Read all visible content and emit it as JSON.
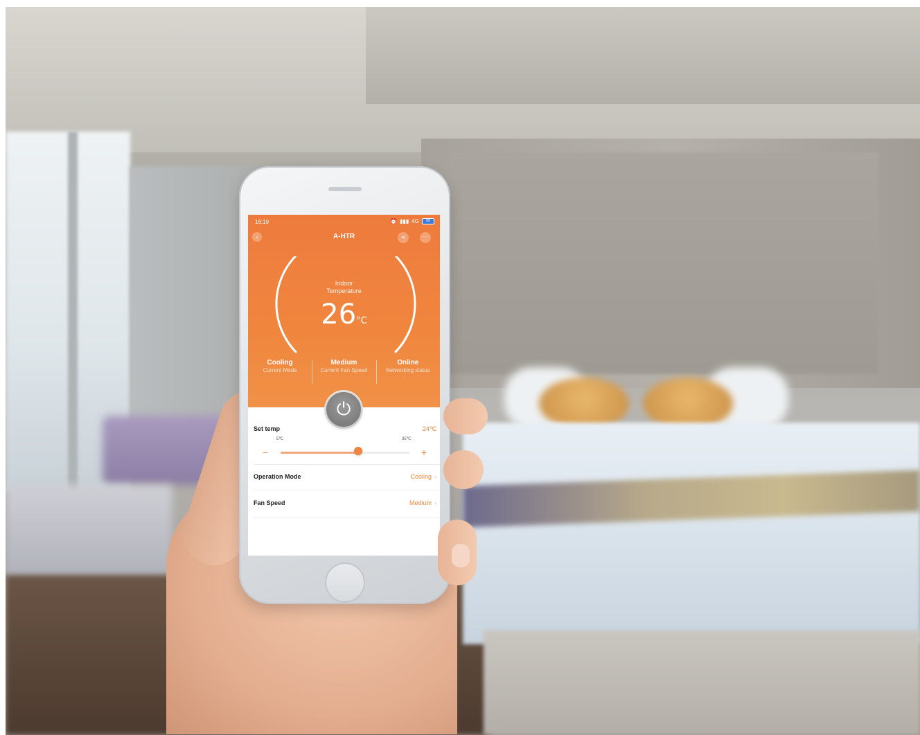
{
  "status_bar": {
    "time": "16:19",
    "icons": [
      "alarm-icon",
      "signal-icon"
    ],
    "network": "4G",
    "battery": "69"
  },
  "nav": {
    "title": "A-HTR",
    "back_icon": "back-icon",
    "share_icon": "share-icon",
    "more_icon": "more-icon"
  },
  "gauge": {
    "label_line1": "Indoor",
    "label_line2": "Temperature",
    "value": "26",
    "unit": "°C"
  },
  "stats": [
    {
      "value": "Cooling",
      "label": "Current Mode"
    },
    {
      "value": "Medium",
      "label": "Current Fan Speed"
    },
    {
      "value": "Online",
      "label": "Networking status"
    }
  ],
  "settings": {
    "set_temp": {
      "label": "Set temp",
      "value": "24℃",
      "min_label": "5℃",
      "max_label": "35℃",
      "fraction": 0.6
    },
    "operation_mode": {
      "label": "Operation Mode",
      "value": "Cooling"
    },
    "fan_speed": {
      "label": "Fan Speed",
      "value": "Medium"
    }
  },
  "colors": {
    "accent": "#f0863e",
    "power_button": "#7a7a7a"
  }
}
